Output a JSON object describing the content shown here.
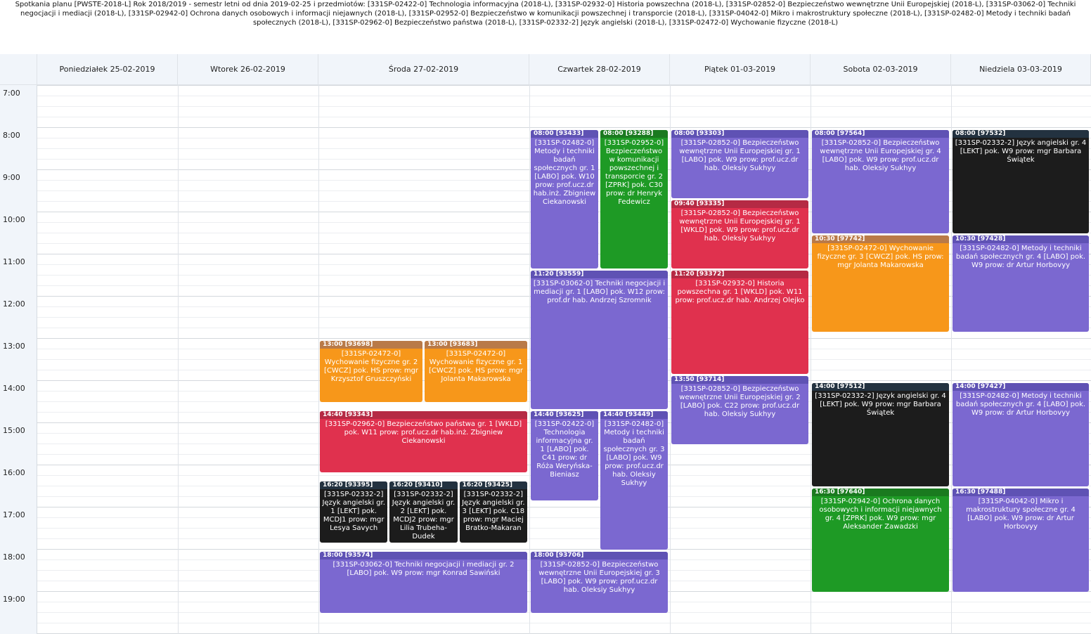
{
  "title": "Spotkania planu [PWSTE-2018-L] Rok 2018/2019 - semestr letni od dnia 2019-02-25 i przedmiotów: [331SP-02422-0] Technologia informacyjna (2018-L), [331SP-02932-0] Historia powszechna (2018-L), [331SP-02852-0] Bezpieczeństwo wewnętrzne Unii Europejskiej (2018-L), [331SP-03062-0] Techniki negocjacji i mediacji (2018-L), [331SP-02942-0] Ochrona danych osobowych i informacji niejawnych (2018-L), [331SP-02952-0] Bezpieczeństwo w komunikacji powszechnej i transporcie (2018-L), [331SP-04042-0] Mikro i makrostruktury społeczne (2018-L), [331SP-02482-0] Metody i techniki badań społecznych (2018-L), [331SP-02962-0] Bezpieczeństwo państwa (2018-L), [331SP-02332-2] Język angielski (2018-L), [331SP-02472-0] Wychowanie fizyczne (2018-L)",
  "days": [
    "Poniedziałek 25-02-2019",
    "Wtorek 26-02-2019",
    "Środa 27-02-2019",
    "Czwartek 28-02-2019",
    "Piątek 01-03-2019",
    "Sobota 02-03-2019",
    "Niedziela 03-03-2019"
  ],
  "hours": [
    "7:00",
    "8:00",
    "9:00",
    "10:00",
    "11:00",
    "12:00",
    "13:00",
    "14:00",
    "15:00",
    "16:00",
    "17:00",
    "18:00",
    "19:00"
  ],
  "colors": {
    "purple": "#7b68d0",
    "red": "#e0314e",
    "orange": "#f7971a",
    "green": "#1e9a25",
    "black": "#1c1c1c"
  },
  "events": [
    {
      "day": 2,
      "sub": 0,
      "subs": 2,
      "start": "13:00",
      "end": "14:30",
      "color": "orange",
      "header": "13:00 [93698]",
      "text": "[331SP-02472-0] Wychowanie fizyczne gr. 2 [CWCZ] pok. HS prow: mgr Krzysztof Gruszczyński"
    },
    {
      "day": 2,
      "sub": 1,
      "subs": 2,
      "start": "13:00",
      "end": "14:30",
      "color": "orange",
      "header": "13:00 [93683]",
      "text": "[331SP-02472-0] Wychowanie fizyczne gr. 1 [CWCZ] pok. HS prow: mgr Jolanta Makarowska"
    },
    {
      "day": 2,
      "sub": 0,
      "subs": 1,
      "start": "14:40",
      "end": "16:10",
      "color": "red",
      "header": "14:40 [93343]",
      "text": "[331SP-02962-0] Bezpieczeństwo państwa gr. 1 [WKLD] pok. W11 prow: prof.ucz.dr hab.inż. Zbigniew Ciekanowski"
    },
    {
      "day": 2,
      "sub": 0,
      "subs": 3,
      "start": "16:20",
      "end": "17:50",
      "color": "black",
      "header": "16:20 [93395]",
      "text": "[331SP-02332-2] Język angielski gr. 1 [LEKT] pok. MCDJ1 prow: mgr Lesya Savych"
    },
    {
      "day": 2,
      "sub": 1,
      "subs": 3,
      "start": "16:20",
      "end": "17:50",
      "color": "black",
      "header": "16:20 [93410]",
      "text": "[331SP-02332-2] Język angielski gr. 2 [LEKT] pok. MCDJ2 prow: mgr Lilia Trubeha-Dudek"
    },
    {
      "day": 2,
      "sub": 2,
      "subs": 3,
      "start": "16:20",
      "end": "17:50",
      "color": "black",
      "header": "16:20 [93425]",
      "text": "[331SP-02332-2] Język angielski gr. 3 [LEKT] pok. C18 prow: mgr Maciej Bratko-Makaran"
    },
    {
      "day": 2,
      "sub": 0,
      "subs": 1,
      "start": "18:00",
      "end": "19:30",
      "color": "purple",
      "header": "18:00 [93574]",
      "text": "[331SP-03062-0] Techniki negocjacji i mediacji gr. 2 [LABO] pok. W9 prow: mgr Konrad Sawiński"
    },
    {
      "day": 3,
      "sub": 0,
      "subs": 2,
      "start": "08:00",
      "end": "11:20",
      "color": "purple",
      "header": "08:00 [93433]",
      "text": "[331SP-02482-0] Metody i techniki badań społecznych gr. 1 [LABO] pok. W10 prow: prof.ucz.dr hab.inż. Zbigniew Ciekanowski"
    },
    {
      "day": 3,
      "sub": 1,
      "subs": 2,
      "start": "08:00",
      "end": "11:20",
      "color": "green",
      "header": "08:00 [93288]",
      "text": "[331SP-02952-0] Bezpieczeństwo w komunikacji powszechnej i transporcie gr. 2 [ZPRK] pok. C30 prow: dr Henryk Fedewicz"
    },
    {
      "day": 3,
      "sub": 0,
      "subs": 1,
      "start": "11:20",
      "end": "14:40",
      "color": "purple",
      "header": "11:20 [93559]",
      "text": "[331SP-03062-0] Techniki negocjacji i mediacji gr. 1 [LABO] pok. W12 prow: prof.dr hab. Andrzej Szromnik"
    },
    {
      "day": 3,
      "sub": 0,
      "subs": 2,
      "start": "14:40",
      "end": "16:50",
      "color": "purple",
      "header": "14:40 [93625]",
      "text": "[331SP-02422-0] Technologia informacyjna gr. 1 [LABO] pok. C41 prow: dr Róża Weryńska-Bieniasz"
    },
    {
      "day": 3,
      "sub": 1,
      "subs": 2,
      "start": "14:40",
      "end": "18:00",
      "color": "purple",
      "header": "14:40 [93449]",
      "text": "[331SP-02482-0] Metody i techniki badań społecznych gr. 3 [LABO] pok. W9 prow: prof.ucz.dr hab. Oleksiy Sukhyy"
    },
    {
      "day": 3,
      "sub": 0,
      "subs": 1,
      "start": "18:00",
      "end": "19:30",
      "color": "purple",
      "header": "18:00 [93706]",
      "text": "[331SP-02852-0] Bezpieczeństwo wewnętrzne Unii Europejskiej gr. 3 [LABO] pok. W9 prow: prof.ucz.dr hab. Oleksiy Sukhyy"
    },
    {
      "day": 4,
      "sub": 0,
      "subs": 1,
      "start": "08:00",
      "end": "09:40",
      "color": "purple",
      "header": "08:00 [93303]",
      "text": "[331SP-02852-0] Bezpieczeństwo wewnętrzne Unii Europejskiej gr. 1 [LABO] pok. W9 prow: prof.ucz.dr hab. Oleksiy Sukhyy"
    },
    {
      "day": 4,
      "sub": 0,
      "subs": 1,
      "start": "09:40",
      "end": "11:20",
      "color": "red",
      "header": "09:40 [93335]",
      "text": "[331SP-02852-0] Bezpieczeństwo wewnętrzne Unii Europejskiej gr. 1 [WKLD] pok. W9 prow: prof.ucz.dr hab. Oleksiy Sukhyy"
    },
    {
      "day": 4,
      "sub": 0,
      "subs": 1,
      "start": "11:20",
      "end": "13:50",
      "color": "red",
      "header": "11:20 [93372]",
      "text": "[331SP-02932-0] Historia powszechna gr. 1 [WKLD] pok. W11 prow: prof.ucz.dr hab. Andrzej Olejko"
    },
    {
      "day": 4,
      "sub": 0,
      "subs": 1,
      "start": "13:50",
      "end": "15:30",
      "color": "purple",
      "header": "13:50 [93714]",
      "text": "[331SP-02852-0] Bezpieczeństwo wewnętrzne Unii Europejskiej gr. 2 [LABO] pok. C22 prow: prof.ucz.dr hab. Oleksiy Sukhyy"
    },
    {
      "day": 5,
      "sub": 0,
      "subs": 1,
      "start": "08:00",
      "end": "10:30",
      "color": "purple",
      "header": "08:00 [97564]",
      "text": "[331SP-02852-0] Bezpieczeństwo wewnętrzne Unii Europejskiej gr. 4 [LABO] pok. W9 prow: prof.ucz.dr hab. Oleksiy Sukhyy"
    },
    {
      "day": 5,
      "sub": 0,
      "subs": 1,
      "start": "10:30",
      "end": "12:50",
      "color": "orange",
      "header": "10:30 [97742]",
      "text": "[331SP-02472-0] Wychowanie fizyczne gr. 3 [CWCZ] pok. HS prow: mgr Jolanta Makarowska"
    },
    {
      "day": 5,
      "sub": 0,
      "subs": 1,
      "start": "14:00",
      "end": "16:30",
      "color": "black",
      "header": "14:00 [97512]",
      "text": "[331SP-02332-2] Język angielski gr. 4 [LEKT] pok. W9 prow: mgr Barbara Świątek"
    },
    {
      "day": 5,
      "sub": 0,
      "subs": 1,
      "start": "16:30",
      "end": "19:00",
      "color": "green",
      "header": "16:30 [97640]",
      "text": "[331SP-02942-0] Ochrona danych osobowych i informacji niejawnych gr. 4 [ZPRK] pok. W9 prow: mgr Aleksander Zawadzki"
    },
    {
      "day": 6,
      "sub": 0,
      "subs": 1,
      "start": "08:00",
      "end": "10:30",
      "color": "black",
      "header": "08:00 [97532]",
      "text": "[331SP-02332-2] Język angielski gr. 4 [LEKT] pok. W9 prow: mgr Barbara Świątek"
    },
    {
      "day": 6,
      "sub": 0,
      "subs": 1,
      "start": "10:30",
      "end": "12:50",
      "color": "purple",
      "header": "10:30 [97428]",
      "text": "[331SP-02482-0] Metody i techniki badań społecznych gr. 4 [LABO] pok. W9 prow: dr Artur Horbovyy"
    },
    {
      "day": 6,
      "sub": 0,
      "subs": 1,
      "start": "14:00",
      "end": "16:30",
      "color": "purple",
      "header": "14:00 [97427]",
      "text": "[331SP-02482-0] Metody i techniki badań społecznych gr. 4 [LABO] pok. W9 prow: dr Artur Horbovyy"
    },
    {
      "day": 6,
      "sub": 0,
      "subs": 1,
      "start": "16:30",
      "end": "19:00",
      "color": "purple",
      "header": "16:30 [97488]",
      "text": "[331SP-04042-0] Mikro i makrostruktury społeczne gr. 4 [LABO] pok. W9 prow: dr Artur Horbovyy"
    }
  ]
}
